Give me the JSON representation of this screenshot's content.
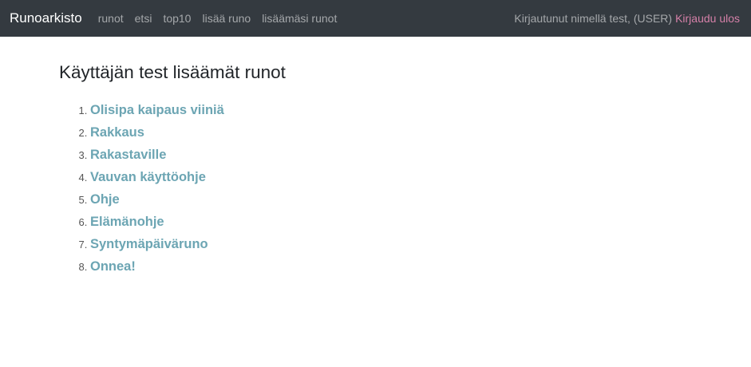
{
  "navbar": {
    "brand": "Runoarkisto",
    "links": [
      {
        "label": "runot"
      },
      {
        "label": "etsi"
      },
      {
        "label": "top10"
      },
      {
        "label": "lisää runo"
      },
      {
        "label": "lisäämäsi runot"
      }
    ],
    "login_status": "Kirjautunut nimellä test, (USER)",
    "logout_label": "Kirjaudu ulos"
  },
  "main": {
    "title": "Käyttäjän test lisäämät runot",
    "poems": [
      {
        "title": "Olisipa kaipaus viiniä"
      },
      {
        "title": "Rakkaus"
      },
      {
        "title": "Rakastaville"
      },
      {
        "title": "Vauvan käyttöohje"
      },
      {
        "title": "Ohje"
      },
      {
        "title": "Elämänohje"
      },
      {
        "title": "Syntymäpäiväruno"
      },
      {
        "title": "Onnea!"
      }
    ]
  },
  "colors": {
    "navbar_bg": "#343a40",
    "link": "#6ca5b3",
    "logout": "#d580a8"
  }
}
